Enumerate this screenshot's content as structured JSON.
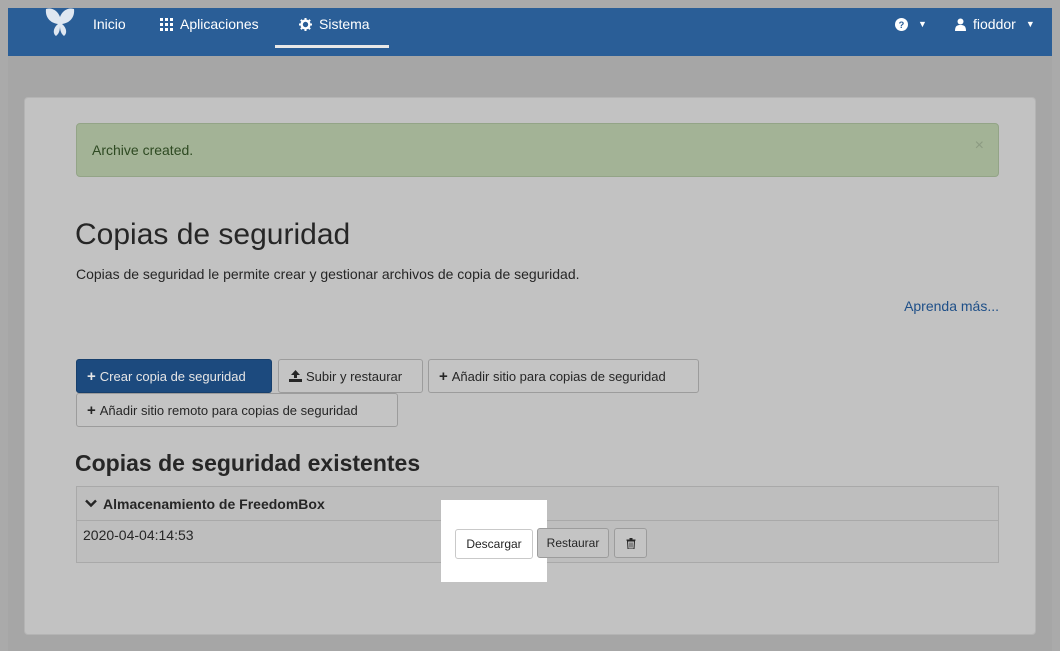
{
  "navbar": {
    "home_label": "Inicio",
    "apps_label": "Aplicaciones",
    "system_label": "Sistema",
    "user_label": "fioddor"
  },
  "alert": {
    "message": "Archive created.",
    "close": "×"
  },
  "page": {
    "title": "Copias de seguridad",
    "description": "Copias de seguridad le permite crear y gestionar archivos de copia de seguridad.",
    "learn_more": "Aprenda más..."
  },
  "actions": {
    "create": "Crear copia de seguridad",
    "upload_restore": "Subir y restaurar",
    "add_location": "Añadir sitio para copias de seguridad",
    "add_remote": "Añadir sitio remoto para copias de seguridad"
  },
  "existing": {
    "title": "Copias de seguridad existentes",
    "storage_name": "Almacenamiento de FreedomBox",
    "archives": [
      {
        "name": "2020-04-04:14:53",
        "download": "Descargar",
        "restore": "Restaurar"
      }
    ]
  },
  "colors": {
    "navbar": "#2a5e97",
    "primary": "#1c4a7e",
    "link": "#1e4f88",
    "alert_bg": "#a3b396"
  }
}
